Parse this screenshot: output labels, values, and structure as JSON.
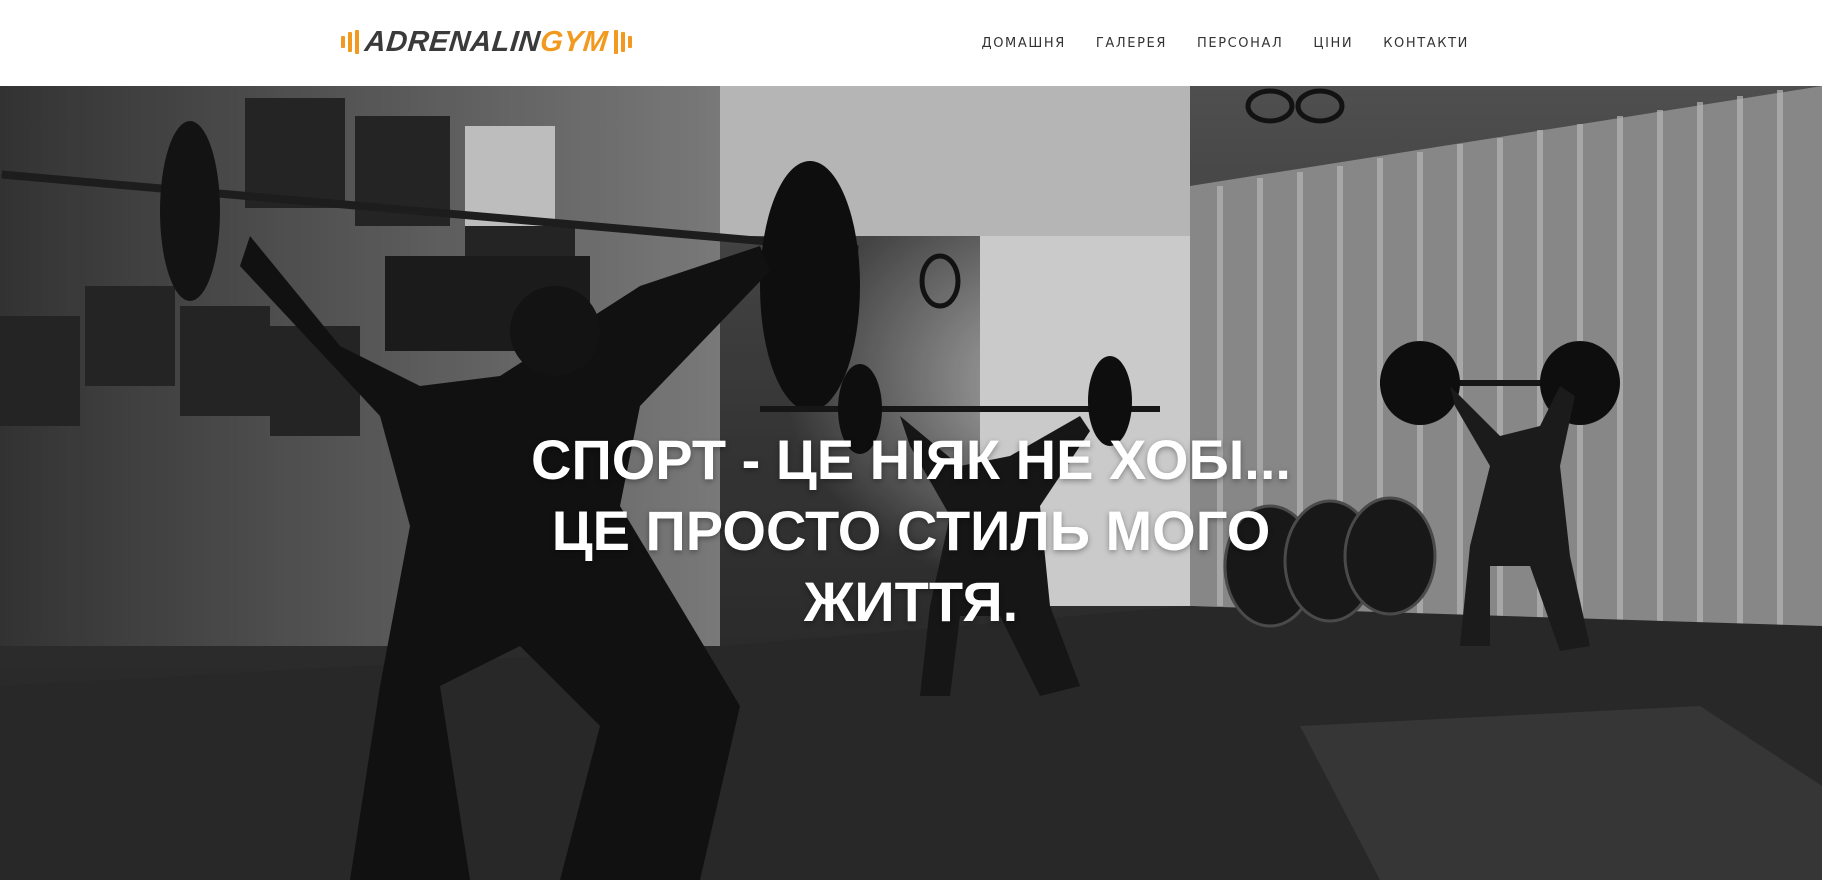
{
  "header": {
    "logo": {
      "part1": "ADRENALIN",
      "part2": "GYM",
      "accent_color": "#f29a1f",
      "dark_color": "#3a3a3a"
    },
    "nav": [
      {
        "label": "ДОМАШНЯ"
      },
      {
        "label": "ГАЛЕРЕЯ"
      },
      {
        "label": "ПЕРСОНАЛ"
      },
      {
        "label": "ЦІНИ"
      },
      {
        "label": "КОНТАКТИ"
      }
    ]
  },
  "hero": {
    "headline": "СПОРТ - ЦЕ НІЯК НЕ ХОБІ... ЦЕ ПРОСТО СТИЛЬ МОГО ЖИТТЯ.",
    "background": "black-and-white photo of athletes doing overhead barbell squats in a gym"
  }
}
